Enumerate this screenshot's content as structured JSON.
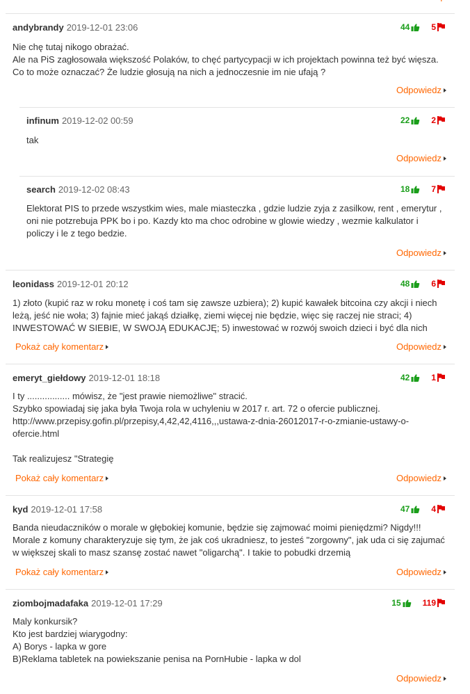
{
  "colors": {
    "accent": "#ff6600",
    "up": "#1a9e1a",
    "down": "#e30000"
  },
  "labels": {
    "reply": "Odpowiedz",
    "show_full": "Pokaż cały komentarz"
  },
  "comments": [
    {
      "author": "andybrandy",
      "date": "2019-12-01 23:06",
      "up": "44",
      "down": "5",
      "body": "Nie chę tutaj nikogo obrażać.\nAle na PiS zagłosowała większość Polaków, to chęć partycypacji w ich projektach powinna też być więsza.\nCo to może oznaczać? Że ludzie głosują na nich a jednoczesnie im nie ufają ?"
    },
    {
      "author": "infinum",
      "date": "2019-12-02 00:59",
      "up": "22",
      "down": "2",
      "body": "tak"
    },
    {
      "author": "search",
      "date": "2019-12-02 08:43",
      "up": "18",
      "down": "7",
      "body": "Elektorat PIS to przede wszystkim wies, male miasteczka , gdzie ludzie zyja z zasilkow, rent , emerytur ,\noni nie potzrebuja PPK bo i po. Kazdy kto ma choc odrobine w glowie wiedzy , wezmie kalkulator i\npoliczy i le z tego bedzie."
    },
    {
      "author": "leonidass",
      "date": "2019-12-01 20:12",
      "up": "48",
      "down": "6",
      "body": "1) złoto (kupić raz w roku monetę i coś tam się zawsze uzbiera); 2) kupić kawałek bitcoina czy akcji i niech\nleżą, jeść nie woła; 3) fajnie mieć jakąś działkę, ziemi więcej nie będzie, więc się raczej nie straci; 4)\nINWESTOWAĆ W SIEBIE, W SWOJĄ EDUKACJĘ; 5) inwestować w rozwój swoich dzieci i być dla nich"
    },
    {
      "author": "emeryt_giełdowy",
      "date": "2019-12-01 18:18",
      "up": "42",
      "down": "1",
      "body": "I ty ................. mówisz, że \"jest prawie niemożliwe\" stracić.\nSzybko spowiadaj się jaka była Twoja rola w uchyleniu w 2017 r. art. 72 o ofercie publicznej.\nhttp://www.przepisy.gofin.pl/przepisy,4,42,42,4116,,,ustawa-z-dnia-26012017-r-o-zmianie-ustawy-o-\nofercie.html\n\nTak realizujesz \"Strategię"
    },
    {
      "author": "kyd",
      "date": "2019-12-01 17:58",
      "up": "47",
      "down": "4",
      "body": "Banda nieudaczników o morale w głębokiej komunie, będzie się zajmować moimi pieniędzmi? Nigdy!!!\nMorale z komuny charakteryzuje się tym, że jak coś ukradniesz, to jesteś \"zorgowny\", jak uda ci się zajumać\nw większej skali to masz szansę zostać nawet \"oligarchą\". I takie to pobudki drzemią"
    },
    {
      "author": "ziombojmadafaka",
      "date": "2019-12-01 17:29",
      "up": "15",
      "down": "119",
      "body": "Maly konkursik?\nKto jest bardziej wiarygodny:\nA) Borys - lapka w gore\nB)Reklama tabletek na powiekszanie penisa na PornHubie - lapka w dol"
    }
  ]
}
